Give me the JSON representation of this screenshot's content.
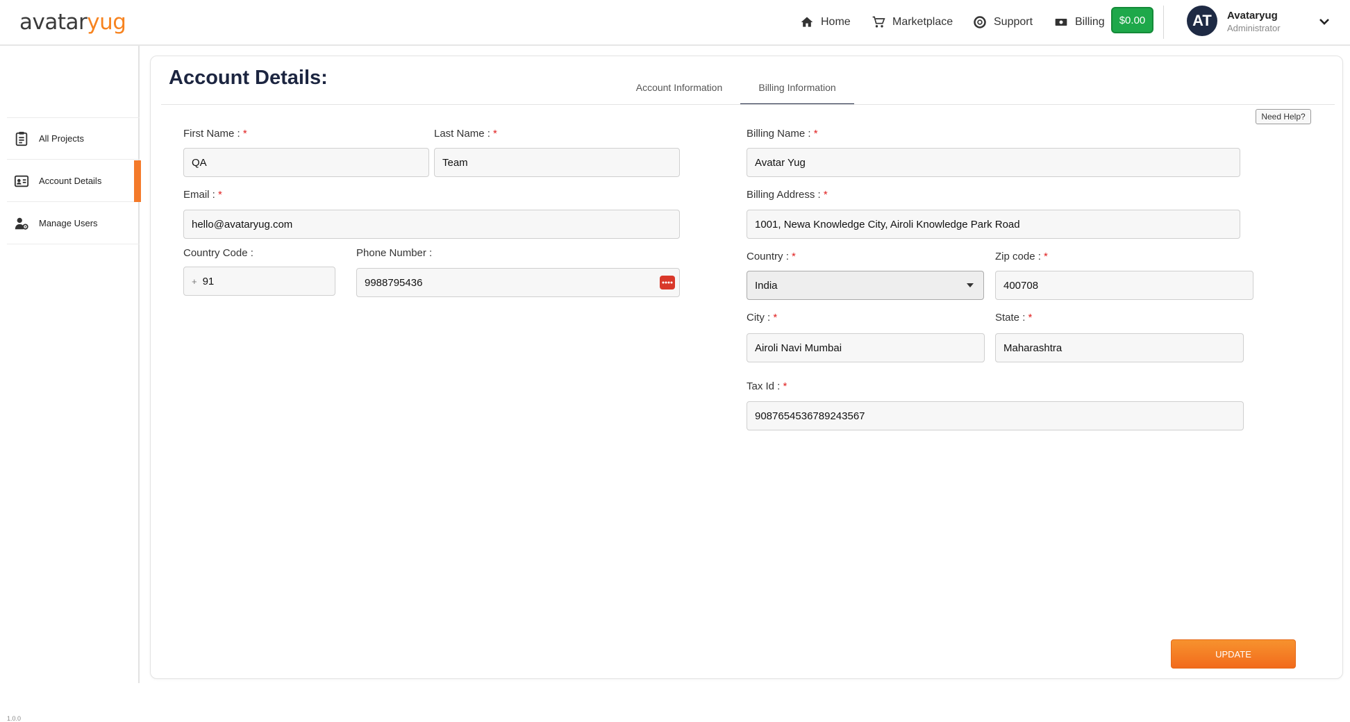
{
  "brand": {
    "logo_part1": "avatar",
    "logo_part2": "yug"
  },
  "nav": {
    "home": "Home",
    "marketplace": "Marketplace",
    "support": "Support",
    "billing": "Billing",
    "credit": "$0.00"
  },
  "user": {
    "initials": "AT",
    "name": "Avataryug",
    "role": "Administrator"
  },
  "sidebar": {
    "items": [
      {
        "label": "All Projects",
        "icon": "clipboard-icon"
      },
      {
        "label": "Account Details",
        "icon": "id-card-icon"
      },
      {
        "label": "Manage Users",
        "icon": "user-gear-icon"
      }
    ],
    "version": "1.0.0"
  },
  "page": {
    "title": "Account Details:",
    "tabs": [
      "Account Information",
      "Billing Information"
    ],
    "help": "Need Help?",
    "update": "UPDATE"
  },
  "account": {
    "first_name_label": "First Name :",
    "first_name": "QA",
    "last_name_label": "Last Name :",
    "last_name": "Team",
    "email_label": "Email :",
    "email": "hello@avataryug.com",
    "country_code_label": "Country Code :",
    "country_code_prefix": "+",
    "country_code": "91",
    "phone_label": "Phone Number :",
    "phone": "9988795436"
  },
  "billing": {
    "name_label": "Billing Name :",
    "name": "Avatar Yug",
    "address_label": "Billing Address :",
    "address": "1001, Newa Knowledge City, Airoli Knowledge Park Road",
    "country_label": "Country :",
    "country": "India",
    "zip_label": "Zip code :",
    "zip": "400708",
    "city_label": "City :",
    "city": "Airoli Navi Mumbai",
    "state_label": "State :",
    "state": "Maharashtra",
    "tax_label": "Tax Id :",
    "tax": "9087654536789243567"
  },
  "required_mark": "*",
  "colors": {
    "accent": "#f47a2a",
    "credit_green": "#1ea84a",
    "title_navy": "#1c2540"
  }
}
